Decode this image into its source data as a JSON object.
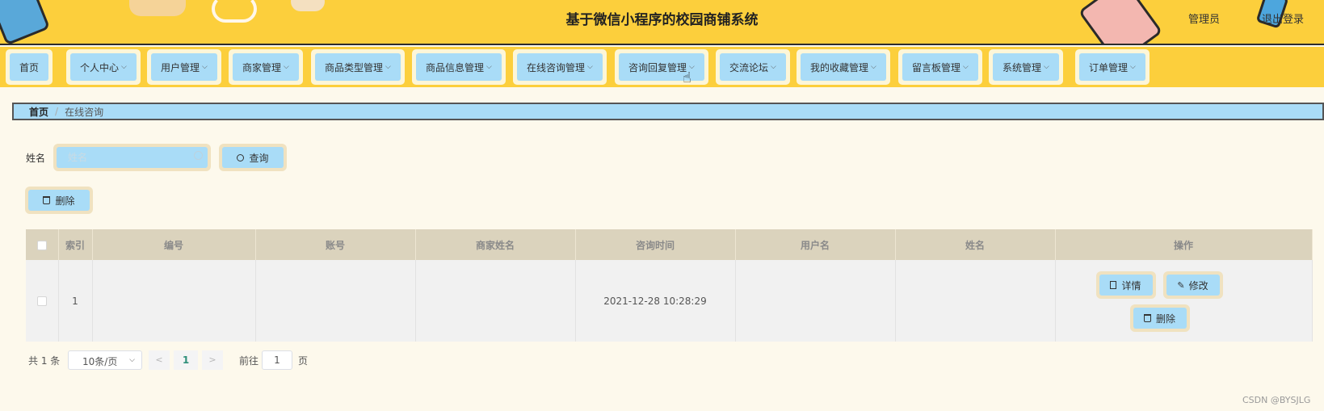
{
  "header": {
    "title": "基于微信小程序的校园商铺系统",
    "user_role": "管理员",
    "logout": "退出登录"
  },
  "nav": {
    "items": [
      {
        "label": "首页",
        "dropdown": false
      },
      {
        "label": "个人中心",
        "dropdown": true
      },
      {
        "label": "用户管理",
        "dropdown": true
      },
      {
        "label": "商家管理",
        "dropdown": true
      },
      {
        "label": "商品类型管理",
        "dropdown": true
      },
      {
        "label": "商品信息管理",
        "dropdown": true
      },
      {
        "label": "在线咨询管理",
        "dropdown": true
      },
      {
        "label": "咨询回复管理",
        "dropdown": true
      },
      {
        "label": "交流论坛",
        "dropdown": true
      },
      {
        "label": "我的收藏管理",
        "dropdown": true
      },
      {
        "label": "留言板管理",
        "dropdown": true
      },
      {
        "label": "系统管理",
        "dropdown": true
      },
      {
        "label": "订单管理",
        "dropdown": true
      }
    ]
  },
  "breadcrumb": {
    "home": "首页",
    "separator": "/",
    "current": "在线咨询"
  },
  "search": {
    "label": "姓名",
    "placeholder": "姓名",
    "button": "查询"
  },
  "actions": {
    "delete": "删除"
  },
  "table": {
    "columns": [
      "",
      "索引",
      "编号",
      "账号",
      "商家姓名",
      "咨询时间",
      "用户名",
      "姓名",
      "操作"
    ],
    "rows": [
      {
        "index": "1",
        "number": "",
        "account": "",
        "merchant_name": "",
        "consult_time": "2021-12-28 10:28:29",
        "username": "",
        "name": "",
        "ops": {
          "detail": "详情",
          "edit": "修改",
          "delete": "删除"
        }
      }
    ]
  },
  "pagination": {
    "total": "共 1 条",
    "page_size": "10条/页",
    "prev": "<",
    "current_page": "1",
    "next": ">",
    "goto_label": "前往",
    "goto_value": "1",
    "page_suffix": "页"
  },
  "watermark": "CSDN @BYSJLG",
  "colors": {
    "header_bg": "#fccf3c",
    "button_bg": "#a9dcf7",
    "button_frame": "#f0e2c0",
    "page_bg": "#fdf9ec",
    "table_header_bg": "#dbd3bd"
  }
}
